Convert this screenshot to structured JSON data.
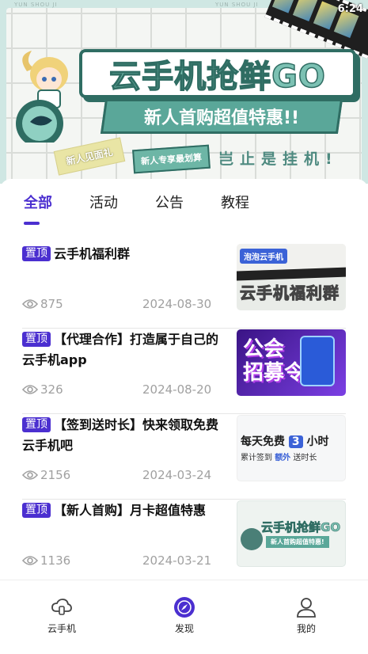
{
  "status": {
    "time": "6:24"
  },
  "banner": {
    "tag_left": "YUN SHOU JI",
    "tag_right": "YUN SHOU JI",
    "title": "云手机抢鲜GO",
    "subtitle": "新人首购超值特惠!!",
    "sticker1": "新人见面礼",
    "sticker2": "新人专享最划算",
    "slogan": "岂止是挂机!"
  },
  "tabs": [
    {
      "label": "全部",
      "active": true
    },
    {
      "label": "活动",
      "active": false
    },
    {
      "label": "公告",
      "active": false
    },
    {
      "label": "教程",
      "active": false
    }
  ],
  "posts": [
    {
      "pin": "置顶",
      "title": "云手机福利群",
      "views": "875",
      "date": "2024-08-30",
      "thumb": {
        "badge": "泡泡云手机",
        "big": "云手机福利群"
      }
    },
    {
      "pin": "置顶",
      "title": "【代理合作】打造属于自己的云手机app",
      "views": "326",
      "date": "2024-08-20",
      "thumb": {
        "big1": "公会",
        "big2": "招募令"
      }
    },
    {
      "pin": "置顶",
      "title": "【签到送时长】快来领取免费云手机吧",
      "views": "2156",
      "date": "2024-03-24",
      "thumb": {
        "l1a": "每天免费",
        "l1n": "3",
        "l1b": "小时",
        "l2a": "累计签到",
        "l2b": "额外",
        "l2c": "送时长"
      }
    },
    {
      "pin": "置顶",
      "title": "【新人首购】月卡超值特惠",
      "views": "1136",
      "date": "2024-03-21",
      "thumb": {
        "title": "云手机抢鲜GO",
        "sub": "新人首购超值特惠!"
      }
    }
  ],
  "nav": [
    {
      "label": "云手机",
      "icon": "cloud-phone-icon",
      "active": false
    },
    {
      "label": "发现",
      "icon": "discover-compass-icon",
      "active": true
    },
    {
      "label": "我的",
      "icon": "user-icon",
      "active": false
    }
  ],
  "colors": {
    "accent": "#4b2fd0",
    "banner_green": "#2f6d63",
    "muted_text": "#a0a0a0"
  }
}
